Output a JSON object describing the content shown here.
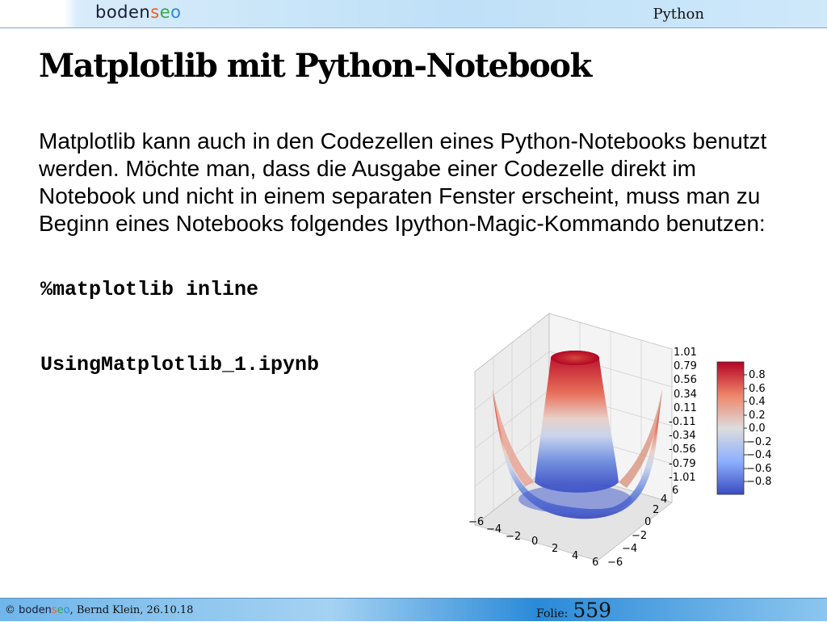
{
  "header": {
    "logo": {
      "part1": "boden",
      "part2": "s",
      "part3": "e",
      "part4": "o"
    },
    "section": "Python"
  },
  "slide": {
    "title": "Matplotlib mit Python-Notebook",
    "paragraph": "Matplotlib kann auch in den Codezellen eines Python-Notebooks benutzt werden. Möchte man, dass die Ausgabe einer Codezelle direkt im Notebook und nicht in einem separaten Fenster erscheint, muss man zu Beginn eines Notebooks folgendes Ipython-Magic-Kommando benutzen:",
    "code_magic": "%matplotlib inline",
    "notebook_file": "UsingMatplotlib_1.ipynb"
  },
  "plot": {
    "z_ticks": [
      "1.01",
      "0.79",
      "0.56",
      "0.34",
      "0.11",
      "-0.11",
      "-0.34",
      "-0.56",
      "-0.79",
      "-1.01"
    ],
    "x_ticks": [
      "−6",
      "−4",
      "−2",
      "0",
      "2",
      "4",
      "6"
    ],
    "y_ticks": [
      "−6",
      "−4",
      "−2",
      "0",
      "2",
      "4",
      "6"
    ],
    "colorbar_ticks": [
      "0.8",
      "0.6",
      "0.4",
      "0.2",
      "0.0",
      "−0.2",
      "−0.4",
      "−0.6",
      "−0.8"
    ],
    "colors": {
      "high": "#b40426",
      "mid": "#dddddd",
      "low": "#3b4cc0"
    }
  },
  "footer": {
    "copyright_prefix": "© ",
    "logo_part1": "boden",
    "logo_part2": "s",
    "logo_part3": "e",
    "logo_part4": "o",
    "author_date": ", Bernd Klein, 26.10.18",
    "slide_label": "Folie:",
    "slide_number": "559"
  }
}
